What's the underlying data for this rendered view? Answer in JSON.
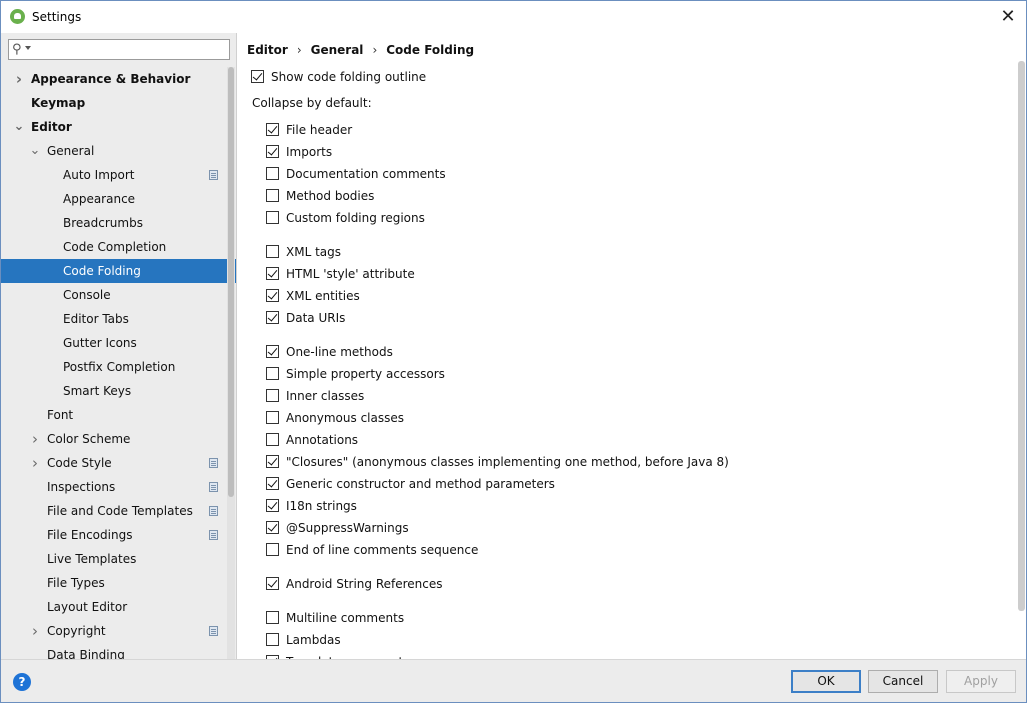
{
  "window": {
    "title": "Settings",
    "close_glyph": "✕"
  },
  "sidebar": {
    "search": {
      "value": "",
      "placeholder": ""
    },
    "items": [
      {
        "label": "Appearance & Behavior",
        "level": 0,
        "bold": true,
        "arrow": "›",
        "page_icon": false,
        "selected": false
      },
      {
        "label": "Keymap",
        "level": 0,
        "bold": true,
        "arrow": "",
        "page_icon": false,
        "selected": false
      },
      {
        "label": "Editor",
        "level": 0,
        "bold": true,
        "arrow": "⌄",
        "page_icon": false,
        "selected": false
      },
      {
        "label": "General",
        "level": 1,
        "bold": false,
        "arrow": "⌄",
        "page_icon": false,
        "selected": false
      },
      {
        "label": "Auto Import",
        "level": 2,
        "bold": false,
        "arrow": "",
        "page_icon": true,
        "selected": false
      },
      {
        "label": "Appearance",
        "level": 2,
        "bold": false,
        "arrow": "",
        "page_icon": false,
        "selected": false
      },
      {
        "label": "Breadcrumbs",
        "level": 2,
        "bold": false,
        "arrow": "",
        "page_icon": false,
        "selected": false
      },
      {
        "label": "Code Completion",
        "level": 2,
        "bold": false,
        "arrow": "",
        "page_icon": false,
        "selected": false
      },
      {
        "label": "Code Folding",
        "level": 2,
        "bold": false,
        "arrow": "",
        "page_icon": false,
        "selected": true
      },
      {
        "label": "Console",
        "level": 2,
        "bold": false,
        "arrow": "",
        "page_icon": false,
        "selected": false
      },
      {
        "label": "Editor Tabs",
        "level": 2,
        "bold": false,
        "arrow": "",
        "page_icon": false,
        "selected": false
      },
      {
        "label": "Gutter Icons",
        "level": 2,
        "bold": false,
        "arrow": "",
        "page_icon": false,
        "selected": false
      },
      {
        "label": "Postfix Completion",
        "level": 2,
        "bold": false,
        "arrow": "",
        "page_icon": false,
        "selected": false
      },
      {
        "label": "Smart Keys",
        "level": 2,
        "bold": false,
        "arrow": "",
        "page_icon": false,
        "selected": false
      },
      {
        "label": "Font",
        "level": 1,
        "bold": false,
        "arrow": "",
        "page_icon": false,
        "selected": false
      },
      {
        "label": "Color Scheme",
        "level": 1,
        "bold": false,
        "arrow": "›",
        "page_icon": false,
        "selected": false
      },
      {
        "label": "Code Style",
        "level": 1,
        "bold": false,
        "arrow": "›",
        "page_icon": true,
        "selected": false
      },
      {
        "label": "Inspections",
        "level": 1,
        "bold": false,
        "arrow": "",
        "page_icon": true,
        "selected": false
      },
      {
        "label": "File and Code Templates",
        "level": 1,
        "bold": false,
        "arrow": "",
        "page_icon": true,
        "selected": false
      },
      {
        "label": "File Encodings",
        "level": 1,
        "bold": false,
        "arrow": "",
        "page_icon": true,
        "selected": false
      },
      {
        "label": "Live Templates",
        "level": 1,
        "bold": false,
        "arrow": "",
        "page_icon": false,
        "selected": false
      },
      {
        "label": "File Types",
        "level": 1,
        "bold": false,
        "arrow": "",
        "page_icon": false,
        "selected": false
      },
      {
        "label": "Layout Editor",
        "level": 1,
        "bold": false,
        "arrow": "",
        "page_icon": false,
        "selected": false
      },
      {
        "label": "Copyright",
        "level": 1,
        "bold": false,
        "arrow": "›",
        "page_icon": true,
        "selected": false
      },
      {
        "label": "Data Binding",
        "level": 1,
        "bold": false,
        "arrow": "",
        "page_icon": false,
        "selected": false
      }
    ]
  },
  "breadcrumb": {
    "items": [
      "Editor",
      "General",
      "Code Folding"
    ],
    "separator": "›"
  },
  "content": {
    "show_outline": {
      "label": "Show code folding outline",
      "checked": true
    },
    "collapse_label": "Collapse by default:",
    "groups": [
      [
        {
          "label": "File header",
          "checked": true
        },
        {
          "label": "Imports",
          "checked": true
        },
        {
          "label": "Documentation comments",
          "checked": false
        },
        {
          "label": "Method bodies",
          "checked": false
        },
        {
          "label": "Custom folding regions",
          "checked": false
        }
      ],
      [
        {
          "label": "XML tags",
          "checked": false
        },
        {
          "label": "HTML 'style' attribute",
          "checked": true
        },
        {
          "label": "XML entities",
          "checked": true
        },
        {
          "label": "Data URIs",
          "checked": true
        }
      ],
      [
        {
          "label": "One-line methods",
          "checked": true
        },
        {
          "label": "Simple property accessors",
          "checked": false
        },
        {
          "label": "Inner classes",
          "checked": false
        },
        {
          "label": "Anonymous classes",
          "checked": false
        },
        {
          "label": "Annotations",
          "checked": false
        },
        {
          "label": "\"Closures\" (anonymous classes implementing one method, before Java 8)",
          "checked": true
        },
        {
          "label": "Generic constructor and method parameters",
          "checked": true
        },
        {
          "label": "I18n strings",
          "checked": true
        },
        {
          "label": "@SuppressWarnings",
          "checked": true
        },
        {
          "label": "End of line comments sequence",
          "checked": false
        }
      ],
      [
        {
          "label": "Android String References",
          "checked": true
        }
      ],
      [
        {
          "label": "Multiline comments",
          "checked": false
        },
        {
          "label": "Lambdas",
          "checked": false
        },
        {
          "label": "Template arguments",
          "checked": true
        }
      ]
    ]
  },
  "footer": {
    "help_glyph": "?",
    "ok_label": "OK",
    "cancel_label": "Cancel",
    "apply_label": "Apply"
  },
  "colors": {
    "selection": "#2675bf",
    "sidebar_bg": "#ececec",
    "help_blue": "#1e73d6"
  }
}
